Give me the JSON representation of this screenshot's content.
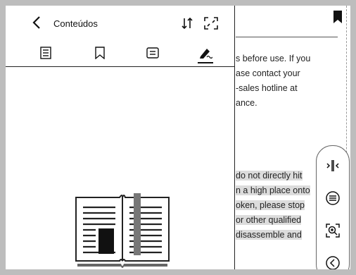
{
  "toc": {
    "title": "Conteúdos",
    "tabs": [
      {
        "icon": "list-icon"
      },
      {
        "icon": "bookmark-outline-icon"
      },
      {
        "icon": "notes-icon"
      },
      {
        "icon": "annotation-pen-icon",
        "active": true
      }
    ]
  },
  "page": {
    "lines1": [
      "s before use. If you",
      "ase  contact  your",
      "-sales  hotline  at",
      "ance."
    ],
    "lines2": [
      "do not directly hit",
      "n a high place onto",
      "oken, please stop",
      " or other qualified",
      "disassemble  and"
    ]
  },
  "tools": [
    {
      "icon": "split-view-icon"
    },
    {
      "icon": "menu-icon"
    },
    {
      "icon": "zoom-icon"
    },
    {
      "icon": "back-circle-icon"
    }
  ]
}
